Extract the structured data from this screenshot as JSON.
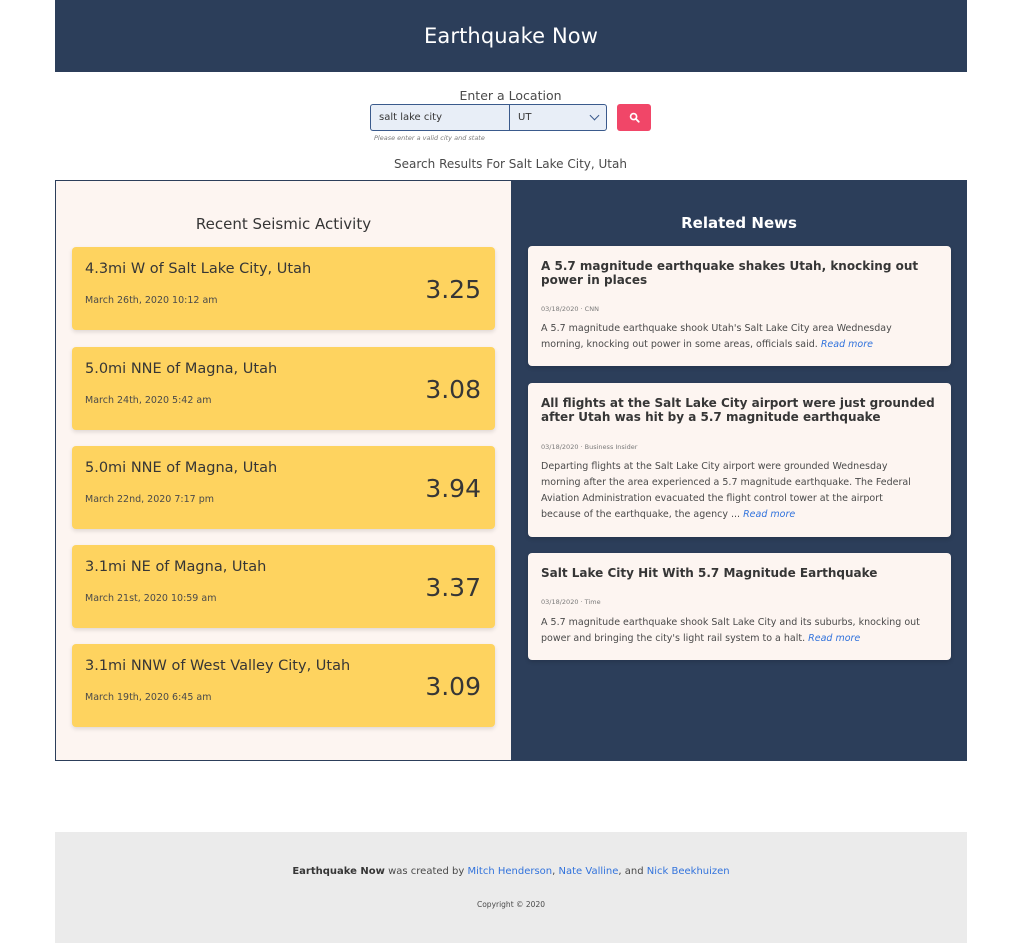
{
  "app": {
    "title": "Earthquake Now"
  },
  "search": {
    "label": "Enter a Location",
    "city_value": "salt lake city",
    "state_value": "UT",
    "help_text": "Please enter a valid city and state",
    "results_title": "Search Results For Salt Lake City, Utah"
  },
  "seismic": {
    "title": "Recent Seismic Activity",
    "items": [
      {
        "location": "4.3mi W of Salt Lake City, Utah",
        "date": "March 26th, 2020 10:12 am",
        "magnitude": "3.25"
      },
      {
        "location": "5.0mi NNE of Magna, Utah",
        "date": "March 24th, 2020 5:42 am",
        "magnitude": "3.08"
      },
      {
        "location": "5.0mi NNE of Magna, Utah",
        "date": "March 22nd, 2020 7:17 pm",
        "magnitude": "3.94"
      },
      {
        "location": "3.1mi NE of Magna, Utah",
        "date": "March 21st, 2020 10:59 am",
        "magnitude": "3.37"
      },
      {
        "location": "3.1mi NNW of West Valley City, Utah",
        "date": "March 19th, 2020 6:45 am",
        "magnitude": "3.09"
      }
    ]
  },
  "news": {
    "title": "Related News",
    "read_more": "Read more",
    "items": [
      {
        "title": "A 5.7 magnitude earthquake shakes Utah, knocking out power in places",
        "meta": "03/18/2020 · CNN",
        "body": "A 5.7 magnitude earthquake shook Utah's Salt Lake City area Wednesday morning, knocking out power in some areas, officials said."
      },
      {
        "title": "All flights at the Salt Lake City airport were just grounded after Utah was hit by a 5.7 magnitude earthquake",
        "meta": "03/18/2020 · Business Insider",
        "body": "Departing flights at the Salt Lake City airport were grounded Wednesday morning after the area experienced a 5.7 magnitude earthquake. The Federal Aviation Administration evacuated the flight control tower at the airport because of the earthquake, the agency ..."
      },
      {
        "title": "Salt Lake City Hit With 5.7 Magnitude Earthquake",
        "meta": "03/18/2020 · Time",
        "body": "A 5.7 magnitude earthquake shook Salt Lake City and its suburbs, knocking out power and bringing the city's light rail system to a halt."
      }
    ]
  },
  "footer": {
    "brand": "Earthquake Now",
    "created_by": "was created by",
    "authors": [
      "Mitch Henderson",
      "Nate Valline",
      "Nick Beekhuizen"
    ],
    "sep1": ",",
    "sep2": ", and",
    "copyright": "Copyright © 2020"
  },
  "colors": {
    "navy": "#2c3e5a",
    "yellow": "#fed35f",
    "cream": "#fdf5f1",
    "danger": "#f14668",
    "link": "#3273dc"
  }
}
